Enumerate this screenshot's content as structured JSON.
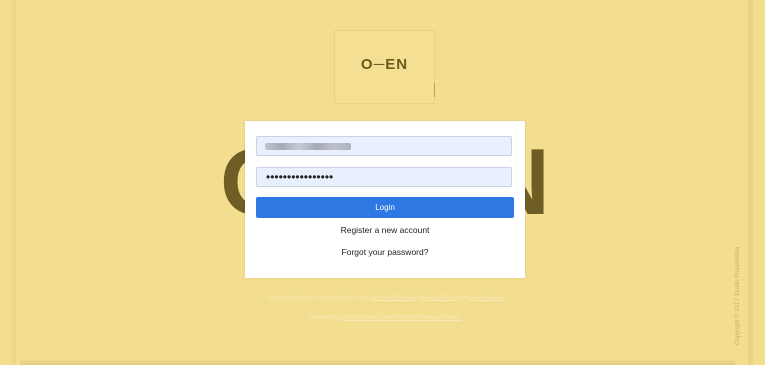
{
  "brand": {
    "logo_text": "O─EN",
    "background_word_left": "O",
    "background_word_right": "N"
  },
  "login": {
    "email_value": "",
    "password_value": "••••••••••••••••",
    "login_label": "Login",
    "register_label": "Register a new account",
    "forgot_label": "Forgot your password?"
  },
  "footer": {
    "terms_prefix": "By proceeding you are agreeing to our",
    "terms_link": "Terms of Service",
    "privacy_link": "Privacy Policy",
    "terms_and": "and",
    "legal_link": "Legal Notice",
    "powered_prefix": "Powered by",
    "powered_link": "Open Source Cloud Platform Package Name"
  },
  "copyright": "Copyright © 2017 Studio Placeholder",
  "colors": {
    "background": "#f3dd8f",
    "accent": "#2e78e4",
    "card": "#ffffff"
  }
}
